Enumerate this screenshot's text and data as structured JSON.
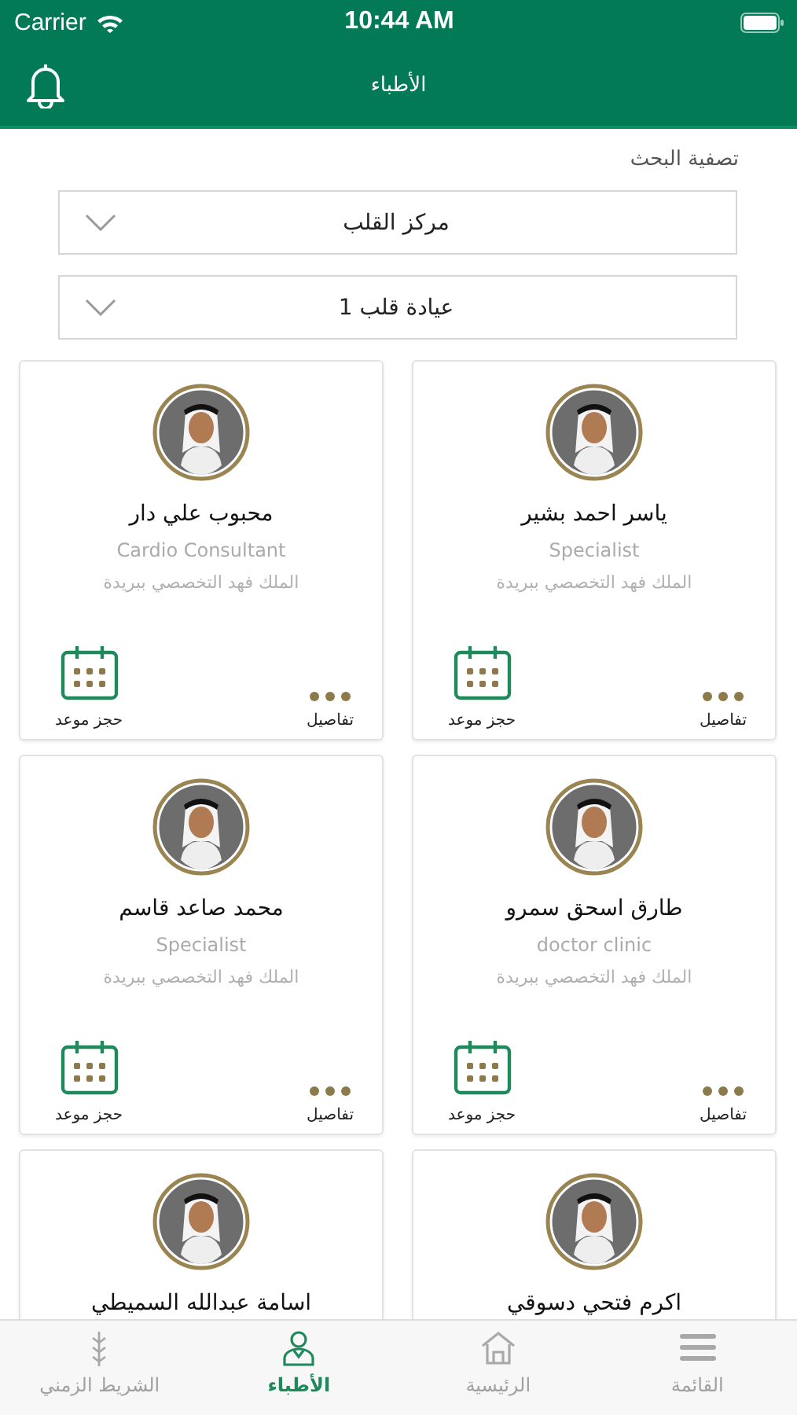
{
  "status_bar": {
    "carrier": "Carrier",
    "time": "10:44 AM"
  },
  "header": {
    "title": "الأطباء"
  },
  "filter": {
    "label": "تصفية البحث",
    "dropdowns": [
      {
        "value": "مركز القلب"
      },
      {
        "value": "عيادة قلب 1"
      }
    ]
  },
  "doctors": [
    {
      "name": "ياسر احمد بشير",
      "specialty": "Specialist",
      "hospital": "الملك فهد التخصصي ببريدة",
      "details": "تفاصيل",
      "book": "حجز موعد"
    },
    {
      "name": "محبوب علي دار",
      "specialty": "Cardio Consultant",
      "hospital": "الملك فهد التخصصي ببريدة",
      "details": "تفاصيل",
      "book": "حجز موعد"
    },
    {
      "name": "طارق اسحق سمرو",
      "specialty": "doctor clinic",
      "hospital": "الملك فهد التخصصي ببريدة",
      "details": "تفاصيل",
      "book": "حجز موعد"
    },
    {
      "name": "محمد صاعد قاسم",
      "specialty": "Specialist",
      "hospital": "الملك فهد التخصصي ببريدة",
      "details": "تفاصيل",
      "book": "حجز موعد"
    },
    {
      "name": "اكرم فتحي دسوقي"
    },
    {
      "name": "اسامة عبدالله السميطي"
    }
  ],
  "tab_bar": [
    {
      "kind": "menu",
      "label": "القائمة",
      "selected": false
    },
    {
      "kind": "home",
      "label": "الرئيسية",
      "selected": false
    },
    {
      "kind": "doctors",
      "label": "الأطباء",
      "selected": true
    },
    {
      "kind": "timeline",
      "label": "الشريط الزمني",
      "selected": false
    }
  ]
}
